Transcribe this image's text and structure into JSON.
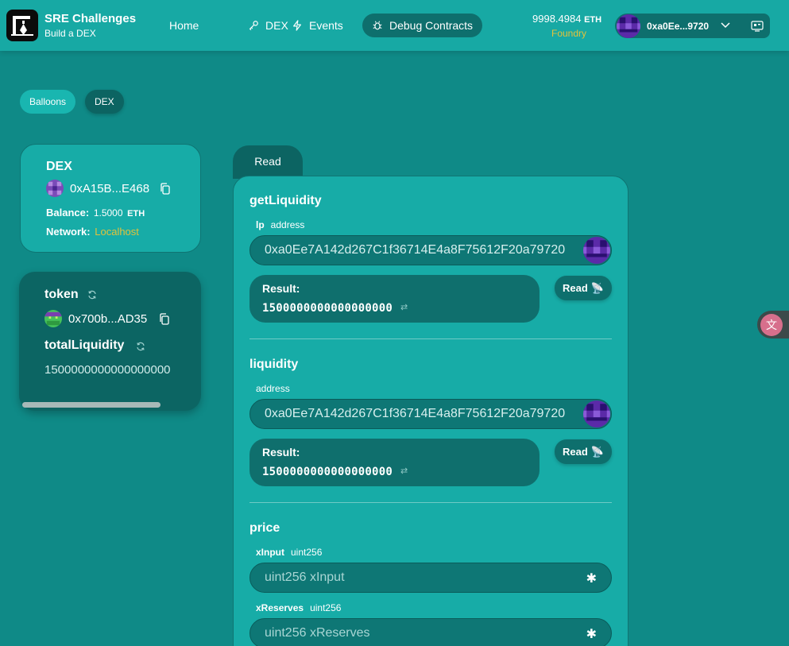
{
  "header": {
    "brand_title": "SRE Challenges",
    "brand_subtitle": "Build a DEX",
    "nav": [
      {
        "label": "Home",
        "icon": "none"
      },
      {
        "label": "DEX",
        "icon": "key-icon"
      },
      {
        "label": "Events",
        "icon": "bolt-icon"
      },
      {
        "label": "Debug Contracts",
        "icon": "bug-icon",
        "active": true
      }
    ],
    "balance_value": "9998.4984",
    "balance_unit": "ETH",
    "network": "Foundry",
    "account": "0xa0Ee...9720"
  },
  "tabs": {
    "balloons": "Balloons",
    "dex": "DEX"
  },
  "contract_card": {
    "name": "DEX",
    "address": "0xA15B...E468",
    "balance_label": "Balance:",
    "balance_value": "1.5000",
    "balance_unit": "ETH",
    "network_label": "Network:",
    "network_value": "Localhost"
  },
  "vars_card": {
    "token_label": "token",
    "token_address": "0x700b...AD35",
    "liquidity_label": "totalLiquidity",
    "liquidity_value": "1500000000000000000"
  },
  "read_tab": "Read",
  "functions": {
    "get_liquidity": {
      "name": "getLiquidity",
      "arg_name": "lp",
      "arg_type": "address",
      "value": "0xa0Ee7A142d267C1f36714E4a8F75612F20a79720",
      "result_label": "Result:",
      "result_value": "1500000000000000000",
      "button": "Read"
    },
    "liquidity": {
      "name": "liquidity",
      "arg_type": "address",
      "value": "0xa0Ee7A142d267C1f36714E4a8F75612F20a79720",
      "result_label": "Result:",
      "result_value": "1500000000000000000",
      "button": "Read"
    },
    "price": {
      "name": "price",
      "arg1_name": "xInput",
      "arg1_type": "uint256",
      "arg1_placeholder": "uint256 xInput",
      "arg2_name": "xReserves",
      "arg2_type": "uint256",
      "arg2_placeholder": "uint256 xReserves"
    }
  },
  "colors": {
    "background": "#0f8a87",
    "header": "#17a9a4",
    "dark_teal": "#0c6462",
    "accent_yellow": "#e3c23a"
  }
}
